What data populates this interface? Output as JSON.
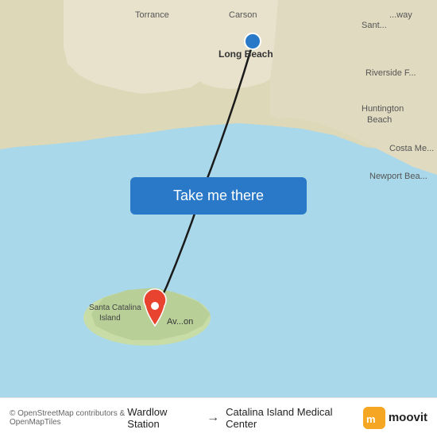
{
  "map": {
    "background_water_color": "#a8d8ea",
    "background_land_color": "#f0e8c8",
    "route_color": "#1a1a1a"
  },
  "button": {
    "label": "Take me there",
    "bg_color": "#2979C8"
  },
  "footer": {
    "attribution": "© OpenStreetMap contributors & OpenMapTiles",
    "origin_label": "Wardlow Station",
    "destination_label": "Catalina Island Medical Center",
    "arrow": "→"
  },
  "moovit": {
    "label": "moovit"
  },
  "pins": {
    "origin_color": "#2979C8",
    "destination_color": "#E8432E"
  }
}
